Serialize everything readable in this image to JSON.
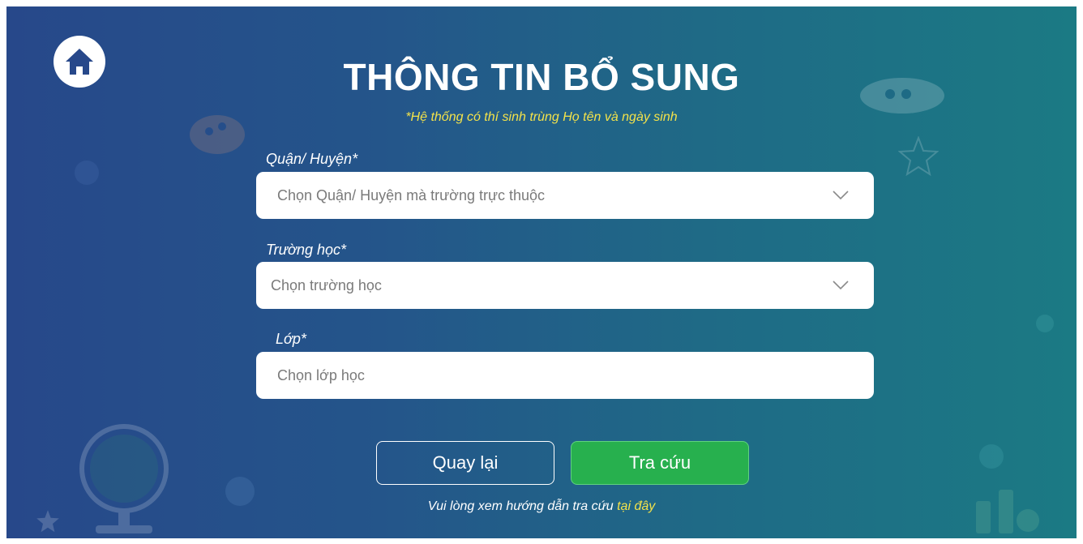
{
  "header": {
    "title": "THÔNG TIN BỔ SUNG",
    "subtitle": "*Hệ thống có thí sinh trùng Họ tên và ngày sinh"
  },
  "form": {
    "district": {
      "label": "Quận/ Huyện*",
      "placeholder": "Chọn Quận/ Huyện mà trường trực thuộc"
    },
    "school": {
      "label": "Trường học*",
      "placeholder": "Chọn trường học"
    },
    "class": {
      "label": "Lớp*",
      "placeholder": "Chọn lớp học"
    }
  },
  "actions": {
    "back_label": "Quay lại",
    "search_label": "Tra cứu"
  },
  "footer": {
    "guide_text": "Vui lòng xem hướng dẫn tra cứu ",
    "guide_link": "tại đây"
  },
  "colors": {
    "accent_yellow": "#f3e24a",
    "button_green": "#27b04e",
    "background_left": "#27488a",
    "background_right": "#1b7a84"
  },
  "icons": {
    "home": "home-icon",
    "dropdown": "chevron-down-icon"
  }
}
